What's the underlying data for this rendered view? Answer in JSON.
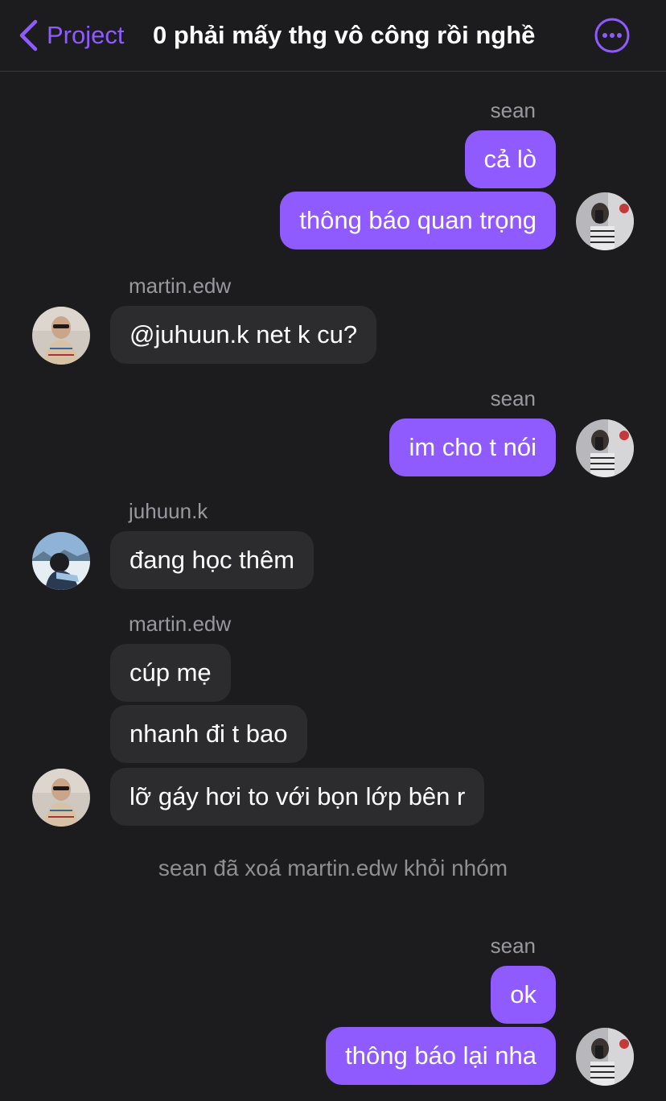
{
  "header": {
    "back_label": "Project",
    "title": "0 phải mấy thg vô công rồi nghề",
    "accent_color": "#8f5bff",
    "more_icon": "ellipsis-circle-icon",
    "back_icon": "chevron-left-icon"
  },
  "messages": {
    "group1": {
      "sender": "sean",
      "bubbles": [
        "cả lò",
        "thông báo quan trọng"
      ]
    },
    "group2": {
      "sender": "martin.edw",
      "bubbles": [
        "@juhuun.k  net k cu?"
      ]
    },
    "group3": {
      "sender": "sean",
      "bubbles": [
        "im cho t nói"
      ]
    },
    "group4": {
      "sender": "juhuun.k",
      "bubbles": [
        "đang học thêm"
      ]
    },
    "group5": {
      "sender": "martin.edw",
      "bubbles": [
        "cúp mẹ",
        "nhanh đi t bao",
        "lỡ gáy hơi to với bọn lớp bên r"
      ]
    },
    "system": "sean đã xoá martin.edw khỏi nhóm",
    "group6": {
      "sender": "sean",
      "bubbles": [
        "ok",
        "thông báo lại nha"
      ]
    }
  },
  "colors": {
    "background": "#1c1c1e",
    "outgoing_bubble": "#8f5bff",
    "incoming_bubble": "#2c2c2e",
    "sender_name": "#98989f"
  }
}
